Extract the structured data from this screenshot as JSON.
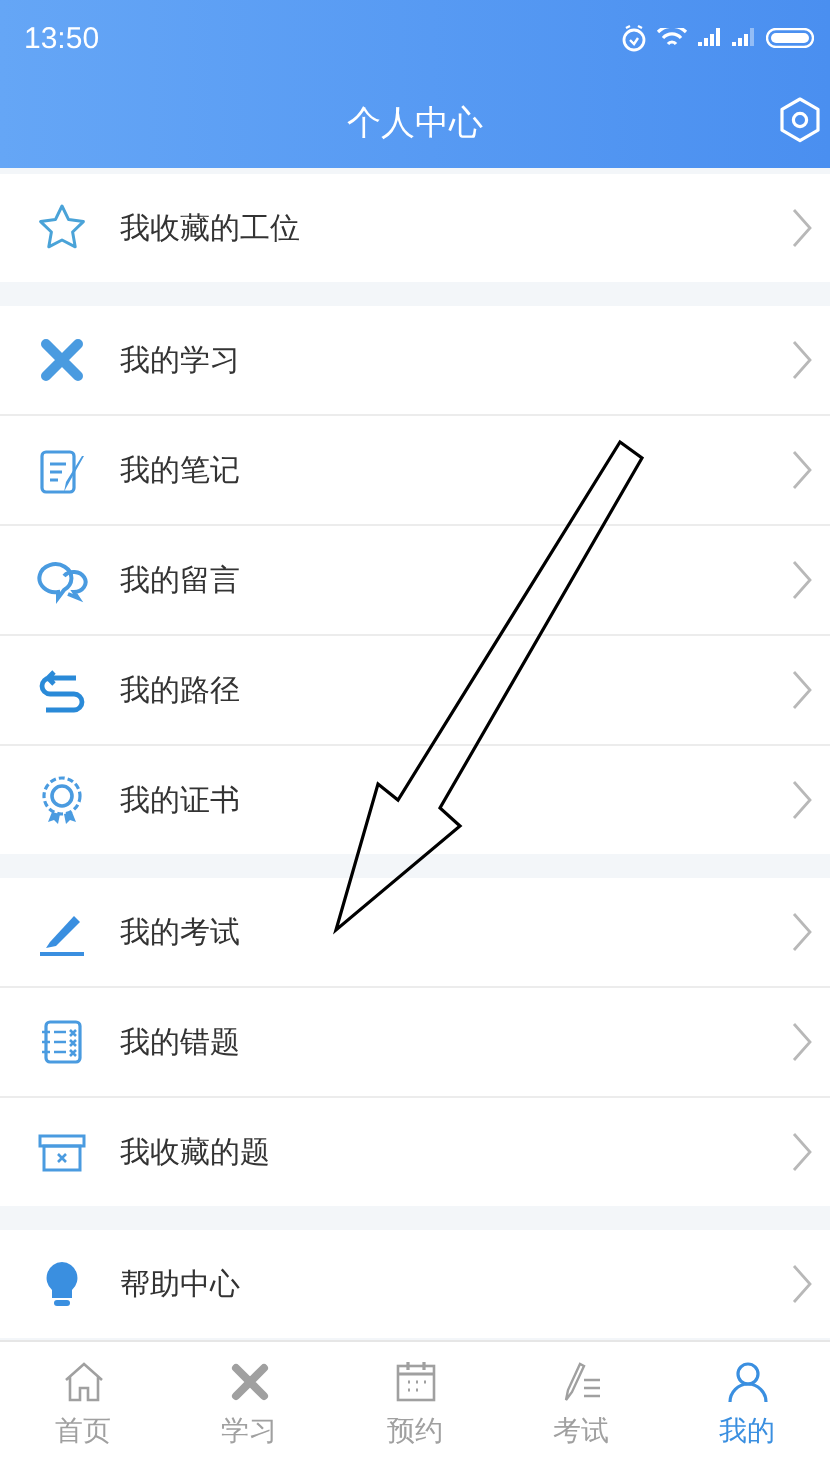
{
  "status_bar": {
    "time": "13:50"
  },
  "header": {
    "title": "个人中心"
  },
  "groups": [
    {
      "items": [
        {
          "label": "我收藏的工位"
        }
      ]
    },
    {
      "items": [
        {
          "label": "我的学习"
        },
        {
          "label": "我的笔记"
        },
        {
          "label": "我的留言"
        },
        {
          "label": "我的路径"
        },
        {
          "label": "我的证书"
        }
      ]
    },
    {
      "items": [
        {
          "label": "我的考试"
        },
        {
          "label": "我的错题"
        },
        {
          "label": "我收藏的题"
        }
      ]
    },
    {
      "items": [
        {
          "label": "帮助中心"
        }
      ]
    }
  ],
  "tab_bar": [
    {
      "label": "首页",
      "selected": false
    },
    {
      "label": "学习",
      "selected": false
    },
    {
      "label": "预约",
      "selected": false
    },
    {
      "label": "考试",
      "selected": false
    },
    {
      "label": "我的",
      "selected": true
    }
  ]
}
